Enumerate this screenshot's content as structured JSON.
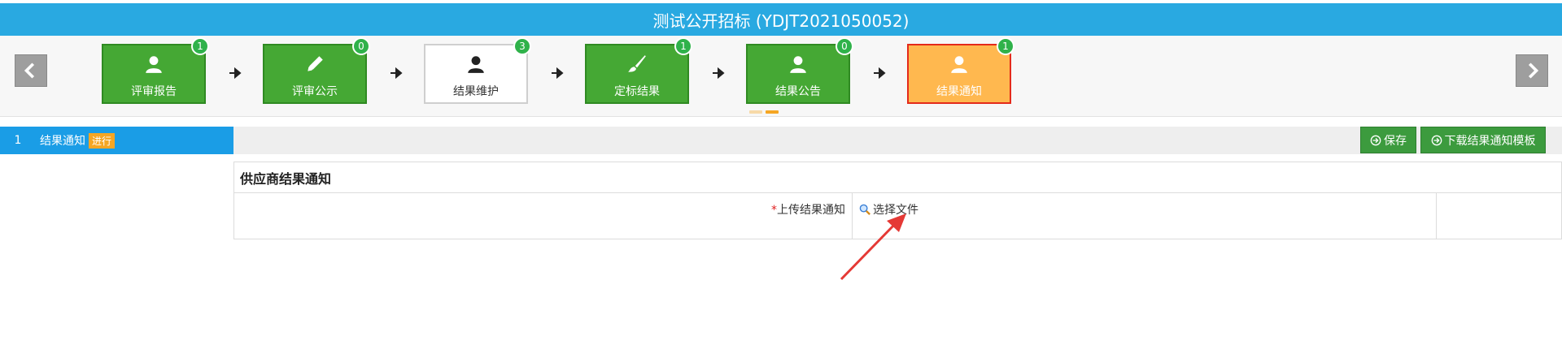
{
  "title": "测试公开招标 (YDJT2021050052)",
  "steps": [
    {
      "label": "评审报告",
      "badge": "1",
      "icon": "user-icon",
      "style": "green"
    },
    {
      "label": "评审公示",
      "badge": "0",
      "icon": "pencil-icon",
      "style": "green"
    },
    {
      "label": "结果维护",
      "badge": "3",
      "icon": "user-icon",
      "style": "white"
    },
    {
      "label": "定标结果",
      "badge": "1",
      "icon": "brush-icon",
      "style": "green"
    },
    {
      "label": "结果公告",
      "badge": "0",
      "icon": "user-icon",
      "style": "green"
    },
    {
      "label": "结果通知",
      "badge": "1",
      "icon": "user-icon",
      "style": "active"
    }
  ],
  "left_panel": {
    "stage_number": "1",
    "stage_label": "结果通知",
    "stage_state": "进行"
  },
  "toolbar": {
    "save_label": "保存",
    "download_label": "下载结果通知模板"
  },
  "form": {
    "section_title": "供应商结果通知",
    "required_mark": "*",
    "upload_label": "上传结果通知",
    "file_picker_label": "选择文件"
  },
  "colors": {
    "title_bar": "#29a9e1",
    "step_green": "#45a834",
    "step_active": "#ffb84f",
    "step_active_border": "#e42a1a",
    "badge": "#2fb24a",
    "left_stage": "#1a9de6",
    "state_badge": "#f5a623",
    "button_green": "#3c9b3e",
    "annotation": "#e53935"
  }
}
